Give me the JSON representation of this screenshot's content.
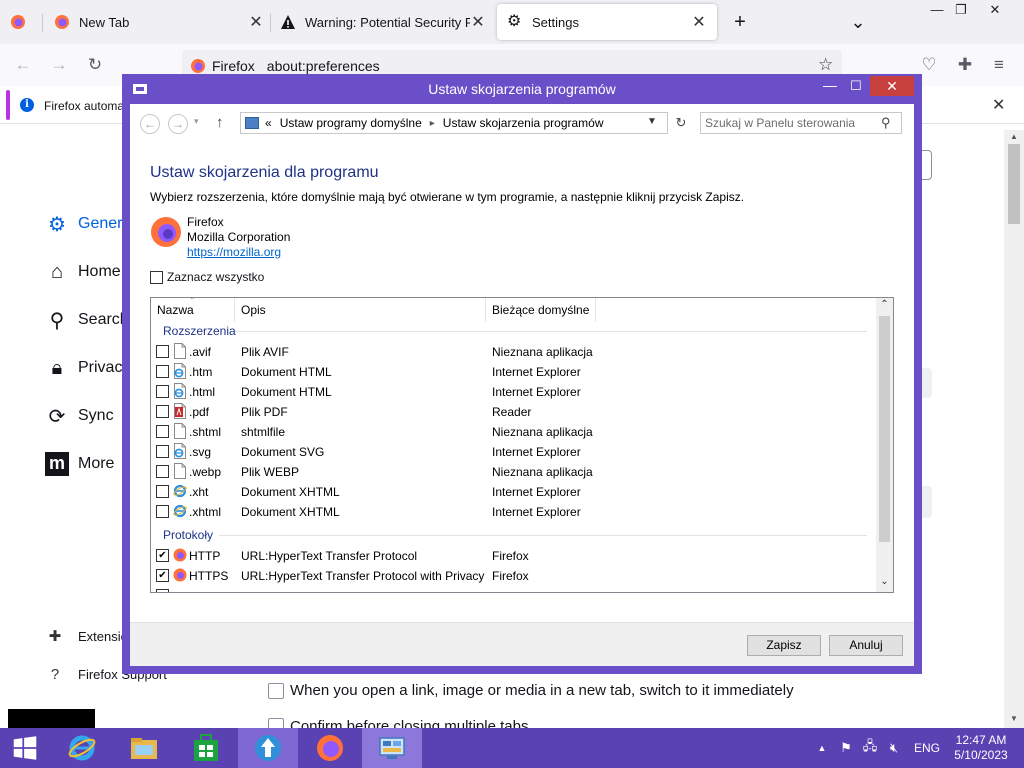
{
  "firefox": {
    "tabs": [
      {
        "label": "",
        "close": ""
      },
      {
        "label": "New Tab",
        "close": "✕"
      },
      {
        "label": "Warning: Potential Security Risk Ahead",
        "close": "✕"
      },
      {
        "label": "Settings",
        "close": "✕"
      }
    ],
    "new_tab": "+",
    "list_tabs": "⌄",
    "window_controls": {
      "minimize": "—",
      "restore": "❐",
      "close": "✕"
    },
    "urlbar": {
      "identity": "Firefox",
      "url": "about:preferences"
    },
    "notification": {
      "text": "Firefox automa"
    },
    "settings": {
      "categories": [
        "General",
        "Home",
        "Search",
        "Privacy",
        "Sync",
        "More"
      ],
      "footer_links": [
        "Extensions & Themes",
        "Firefox Support"
      ],
      "pref_rows": [
        "When you open a link, image or media in a new tab, switch to it immediately",
        "Confirm before closing multiple tabs"
      ]
    },
    "accent_color": "#0061e0"
  },
  "dialog": {
    "title": "Ustaw skojarzenia programów",
    "window_controls": {
      "minimize": "—",
      "maximize": "☐",
      "close": "✕"
    },
    "breadcrumb": {
      "root": "«",
      "items": [
        "Ustaw programy domyślne",
        "Ustaw skojarzenia programów"
      ]
    },
    "search_placeholder": "Szukaj w Panelu sterowania",
    "heading": "Ustaw skojarzenia dla programu",
    "instruction": "Wybierz rozszerzenia, które domyślnie mają być otwierane w tym programie, a następnie kliknij przycisk Zapisz.",
    "app": {
      "name": "Firefox",
      "company": "Mozilla Corporation",
      "url": "https://mozilla.org"
    },
    "select_all": "Zaznacz wszystko",
    "columns": [
      "Nazwa",
      "Opis",
      "Bieżące domyślne"
    ],
    "groups": {
      "extensions": "Rozszerzenia",
      "protocols": "Protokoły"
    },
    "extensions": [
      {
        "name": ".avif",
        "desc": "Plik AVIF",
        "default": "Nieznana aplikacja",
        "checked": false,
        "icon": "blank-file-icon"
      },
      {
        "name": ".htm",
        "desc": "Dokument HTML",
        "default": "Internet Explorer",
        "checked": false,
        "icon": "ie-file-icon"
      },
      {
        "name": ".html",
        "desc": "Dokument HTML",
        "default": "Internet Explorer",
        "checked": false,
        "icon": "ie-file-icon"
      },
      {
        "name": ".pdf",
        "desc": "Plik PDF",
        "default": "Reader",
        "checked": false,
        "icon": "pdf-file-icon"
      },
      {
        "name": ".shtml",
        "desc": "shtmlfile",
        "default": "Nieznana aplikacja",
        "checked": false,
        "icon": "blank-file-icon"
      },
      {
        "name": ".svg",
        "desc": "Dokument SVG",
        "default": "Internet Explorer",
        "checked": false,
        "icon": "ie-file-icon"
      },
      {
        "name": ".webp",
        "desc": "Plik WEBP",
        "default": "Nieznana aplikacja",
        "checked": false,
        "icon": "blank-file-icon"
      },
      {
        "name": ".xht",
        "desc": "Dokument XHTML",
        "default": "Internet Explorer",
        "checked": false,
        "icon": "ie-icon"
      },
      {
        "name": ".xhtml",
        "desc": "Dokument XHTML",
        "default": "Internet Explorer",
        "checked": false,
        "icon": "ie-icon"
      }
    ],
    "protocols": [
      {
        "name": "HTTP",
        "desc": "URL:HyperText Transfer Protocol",
        "default": "Firefox",
        "checked": true,
        "icon": "firefox-icon"
      },
      {
        "name": "HTTPS",
        "desc": "URL:HyperText Transfer Protocol with Privacy",
        "default": "Firefox",
        "checked": true,
        "icon": "firefox-icon"
      }
    ],
    "buttons": {
      "save": "Zapisz",
      "cancel": "Anuluj"
    },
    "frame_color": "#6a4fc8"
  },
  "taskbar": {
    "apps": [
      "start",
      "internet-explorer",
      "file-explorer",
      "store",
      "installer",
      "firefox",
      "control-panel"
    ],
    "language": "ENG",
    "time": "12:47 AM",
    "date": "5/10/2023",
    "color": "#5b42b3"
  }
}
